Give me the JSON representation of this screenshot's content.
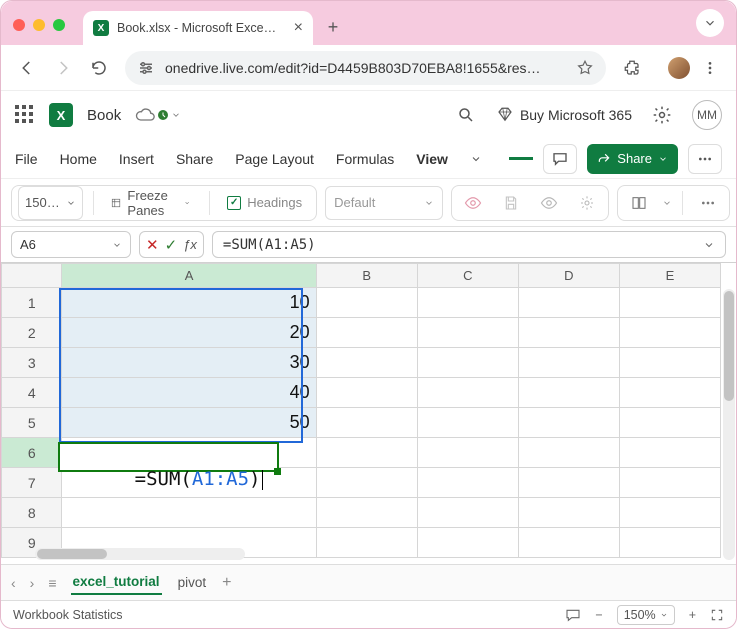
{
  "browser": {
    "tab_title": "Book.xlsx - Microsoft Excel O",
    "url": "onedrive.live.com/edit?id=D4459B803D70EBA8!1655&res…"
  },
  "header": {
    "doc_name": "Book",
    "buy_label": "Buy Microsoft 365",
    "user_initials": "MM"
  },
  "ribbon": {
    "tabs": {
      "file": "File",
      "home": "Home",
      "insert": "Insert",
      "share": "Share",
      "page_layout": "Page Layout",
      "formulas": "Formulas",
      "view": "View"
    },
    "share_btn": "Share",
    "zoom_pct": "150…",
    "freeze": "Freeze Panes",
    "headings": "Headings",
    "sheetview": "Default"
  },
  "fx": {
    "name_box": "A6",
    "formula": "=SUM(A1:A5)",
    "formula_prefix": "=SUM(",
    "formula_range": "A1:A5",
    "formula_suffix": ")"
  },
  "grid": {
    "columns": [
      "A",
      "B",
      "C",
      "D",
      "E"
    ],
    "rows": [
      "1",
      "2",
      "3",
      "4",
      "5",
      "6",
      "7",
      "8",
      "9"
    ],
    "a_values": [
      "10",
      "20",
      "30",
      "40",
      "50"
    ],
    "edit_prefix": "=SUM(",
    "edit_range": "A1:A5",
    "edit_suffix": ")"
  },
  "sheets": {
    "active": "excel_tutorial",
    "other": "pivot"
  },
  "status": {
    "left": "Workbook Statistics",
    "zoom": "150%"
  }
}
